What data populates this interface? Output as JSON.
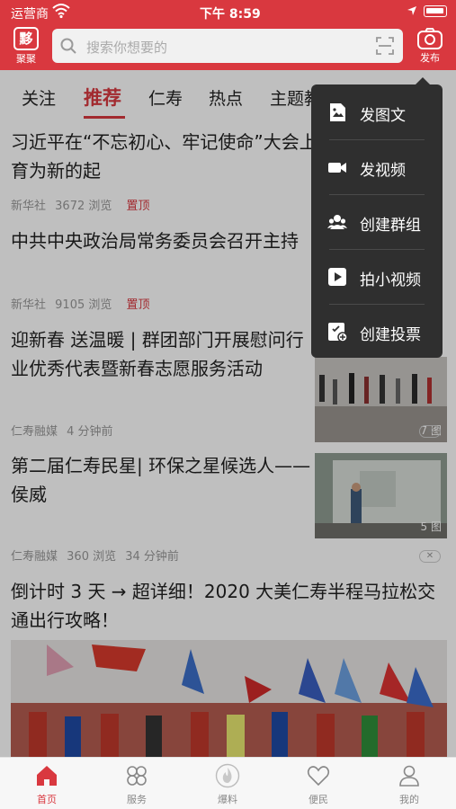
{
  "status": {
    "carrier": "运营商",
    "time": "下午 8:59"
  },
  "header": {
    "logo_char": "黟",
    "logo_label": "聚聚",
    "search_placeholder": "搜索你想要的",
    "publish_label": "发布"
  },
  "tabs": [
    {
      "label": "关注",
      "active": false
    },
    {
      "label": "推荐",
      "active": true
    },
    {
      "label": "仁寿",
      "active": false
    },
    {
      "label": "热点",
      "active": false
    },
    {
      "label": "主题教",
      "active": false
    }
  ],
  "news": [
    {
      "title": "习近平在“不忘初心、牢记使命”大会上强调 以主题教育为新的起",
      "source": "新华社",
      "views": "3672 浏览",
      "tag": "置顶"
    },
    {
      "title": "中共中央政治局常务委员会召开主持",
      "source": "新华社",
      "views": "9105 浏览",
      "tag": "置顶"
    },
    {
      "title": "迎新春 送温暖 | 群团部门开展慰问行业优秀代表暨新春志愿服务活动",
      "source": "仁寿融媒",
      "time": "4 分钟前",
      "img_count": "7 图"
    },
    {
      "title": "第二届仁寿民星| 环保之星候选人——侯威",
      "source": "仁寿融媒",
      "views": "360 浏览",
      "time": "34 分钟前",
      "img_count": "5 图"
    },
    {
      "title": "倒计时 3 天 → 超详细！2020 大美仁寿半程马拉松交通出行攻略！"
    }
  ],
  "menu": [
    {
      "label": "发图文",
      "icon": "image-text-icon"
    },
    {
      "label": "发视频",
      "icon": "video-camera-icon"
    },
    {
      "label": "创建群组",
      "icon": "group-icon"
    },
    {
      "label": "拍小视频",
      "icon": "play-icon"
    },
    {
      "label": "创建投票",
      "icon": "vote-icon"
    }
  ],
  "bottom_nav": [
    {
      "label": "首页",
      "active": true
    },
    {
      "label": "服务",
      "active": false
    },
    {
      "label": "爆料",
      "active": false
    },
    {
      "label": "便民",
      "active": false
    },
    {
      "label": "我的",
      "active": false
    }
  ],
  "colors": {
    "brand": "#d9383f",
    "menu_bg": "#2f2f2f"
  }
}
